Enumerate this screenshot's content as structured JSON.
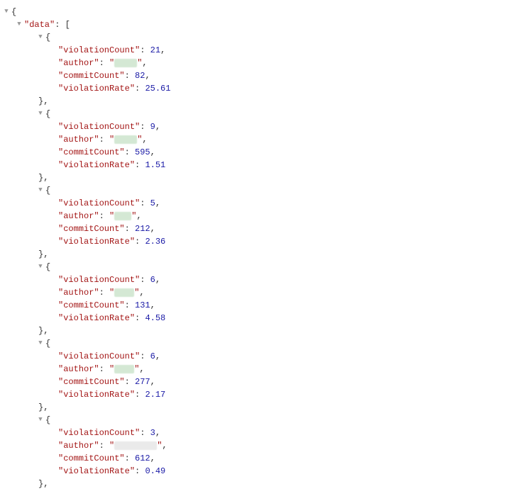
{
  "root_key": "data",
  "entries": [
    {
      "violationCount": 21,
      "author_redacted_width": 32,
      "commitCount": 82,
      "violationRate": 25.61
    },
    {
      "violationCount": 9,
      "author_redacted_width": 32,
      "commitCount": 595,
      "violationRate": 1.51
    },
    {
      "violationCount": 5,
      "author_redacted_width": 24,
      "commitCount": 212,
      "violationRate": 2.36
    },
    {
      "violationCount": 6,
      "author_redacted_width": 28,
      "commitCount": 131,
      "violationRate": 4.58
    },
    {
      "violationCount": 6,
      "author_redacted_width": 28,
      "commitCount": 277,
      "violationRate": 2.17
    },
    {
      "violationCount": 3,
      "author_redacted_width": 60,
      "commitCount": 612,
      "violationRate": 0.49
    }
  ],
  "labels": {
    "violationCount": "violationCount",
    "author": "author",
    "commitCount": "commitCount",
    "violationRate": "violationRate"
  },
  "glyphs": {
    "toggle_open": "▼"
  }
}
